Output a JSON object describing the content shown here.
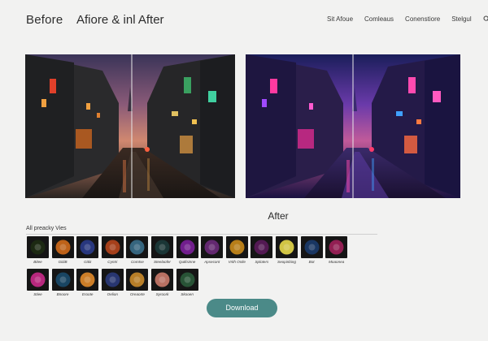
{
  "header": {
    "brand": "Before",
    "title": "Afiore & inl After",
    "nav": [
      "Sit Afoue",
      "Comleaus",
      "Conenstiore",
      "Stelgul"
    ]
  },
  "icons": {
    "search": "search-icon"
  },
  "panels": {
    "after_label": "After"
  },
  "presets": {
    "title": "All preacky Vies",
    "items": [
      {
        "label": "Bitee",
        "color": "#1d2b12"
      },
      {
        "label": "GitiiB",
        "color": "#d06a1a"
      },
      {
        "label": "GitiiI",
        "color": "#2a3b8a"
      },
      {
        "label": "Cyntri",
        "color": "#b5451c"
      },
      {
        "label": "Comtse",
        "color": "#3a6e8a"
      },
      {
        "label": "Steelaofer",
        "color": "#1b3a3a"
      },
      {
        "label": "Qutlisinne",
        "color": "#7b1f9a"
      },
      {
        "label": "Apsecont",
        "color": "#6b2a7a"
      },
      {
        "label": "Vrith Onlie",
        "color": "#c98a1a"
      },
      {
        "label": "Sploters",
        "color": "#5a1a5a"
      },
      {
        "label": "Seopinbing",
        "color": "#e6d84a"
      },
      {
        "label": "Bot",
        "color": "#1a3a6a"
      },
      {
        "label": "Moaonea",
        "color": "#a0205a"
      },
      {
        "label": "Stiee",
        "color": "#c92a8a"
      },
      {
        "label": "Bnoore",
        "color": "#1a4a6a"
      },
      {
        "label": "Eroote",
        "color": "#e08a2a"
      },
      {
        "label": "Oelion",
        "color": "#2a3a7a"
      },
      {
        "label": "Oreaorte",
        "color": "#c98a2a"
      },
      {
        "label": "Syroork",
        "color": "#c97a6a"
      },
      {
        "label": "Skooen",
        "color": "#2a5a3a"
      }
    ]
  },
  "actions": {
    "download": "Download"
  }
}
